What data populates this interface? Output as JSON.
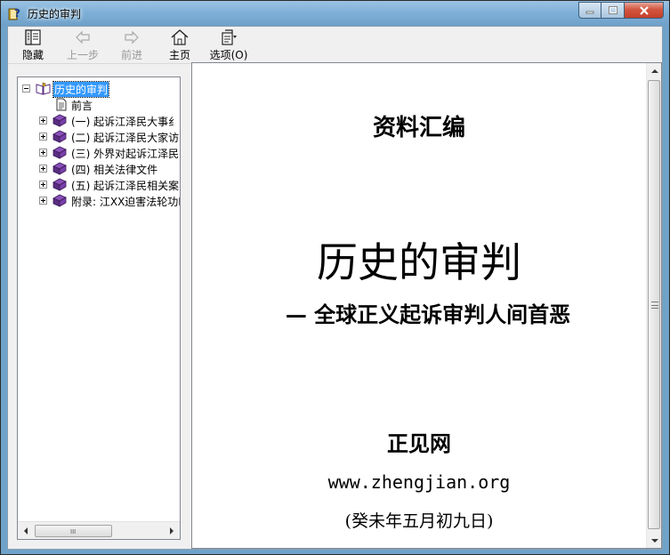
{
  "window": {
    "title": "历史的审判",
    "app_icon": "help-book-icon",
    "colors": {
      "titlebar": "#7fb0d8",
      "close": "#c43f2a",
      "selection": "#3399ff"
    }
  },
  "toolbar": {
    "hide_label": "隐藏",
    "back_label": "上一步",
    "forward_label": "前进",
    "home_label": "主页",
    "options_label": "选项(O)"
  },
  "tree": {
    "root": "历史的审判",
    "items": [
      {
        "label": "前言",
        "icon": "page-icon",
        "expandable": false
      },
      {
        "label": "(一)  起诉江泽民大事纟",
        "icon": "closed-book-icon",
        "expandable": true
      },
      {
        "label": "(二)  起诉江泽民大家访",
        "icon": "closed-book-icon",
        "expandable": true
      },
      {
        "label": "(三) 外界对起诉江泽民",
        "icon": "closed-book-icon",
        "expandable": true
      },
      {
        "label": "(四) 相关法律文件",
        "icon": "closed-book-icon",
        "expandable": true
      },
      {
        "label": "(五) 起诉江泽民相关案",
        "icon": "closed-book-icon",
        "expandable": true
      },
      {
        "label": "附录: 江XX迫害法轮功E",
        "icon": "closed-book-icon",
        "expandable": true
      }
    ]
  },
  "content": {
    "heading1": "资料汇编",
    "heading2": "历史的审判",
    "subtitle": "— 全球正义起诉审判人间首恶",
    "site": "正见网",
    "url": "www.zhengjian.org",
    "date": "(癸未年五月初九日)"
  },
  "scroll": {
    "h_grip": "III"
  }
}
